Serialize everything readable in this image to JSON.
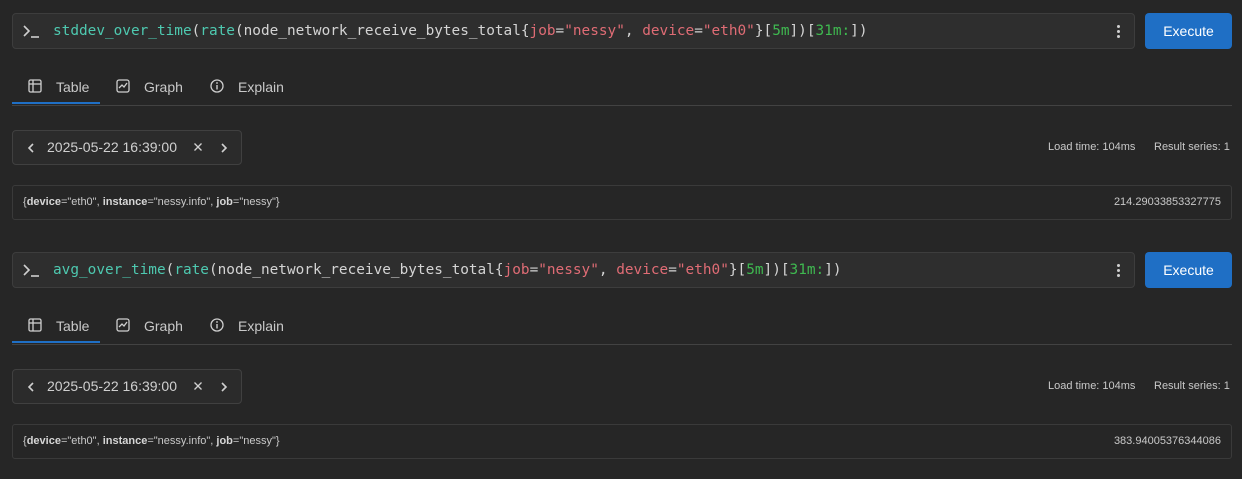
{
  "panels": [
    {
      "query": {
        "fn": "stddev_over_time",
        "inner_fn": "rate",
        "metric": "node_network_receive_bytes_total",
        "label1_name": "job",
        "label1_value": "\"nessy\"",
        "label2_name": "device",
        "label2_value": "\"eth0\"",
        "range": "5m",
        "subquery": "31m:"
      },
      "execute_label": "Execute",
      "tabs": [
        {
          "label": "Table",
          "icon": "table-icon",
          "active": true
        },
        {
          "label": "Graph",
          "icon": "graph-icon",
          "active": false
        },
        {
          "label": "Explain",
          "icon": "info-icon",
          "active": false
        }
      ],
      "eval_time": "2025-05-22 16:39:00",
      "load_time": "Load time: 104ms",
      "result_series": "Result series: 1",
      "result": {
        "open_brace": "{",
        "l1_name": "device",
        "l1_eq": "=\"eth0\", ",
        "l2_name": "instance",
        "l2_eq": "=\"nessy.info\", ",
        "l3_name": "job",
        "l3_eq": "=\"nessy\"",
        "close_brace": "}",
        "value": "214.29033853327775"
      }
    },
    {
      "query": {
        "fn": "avg_over_time",
        "inner_fn": "rate",
        "metric": "node_network_receive_bytes_total",
        "label1_name": "job",
        "label1_value": "\"nessy\"",
        "label2_name": "device",
        "label2_value": "\"eth0\"",
        "range": "5m",
        "subquery": "31m:"
      },
      "execute_label": "Execute",
      "tabs": [
        {
          "label": "Table",
          "icon": "table-icon",
          "active": true
        },
        {
          "label": "Graph",
          "icon": "graph-icon",
          "active": false
        },
        {
          "label": "Explain",
          "icon": "info-icon",
          "active": false
        }
      ],
      "eval_time": "2025-05-22 16:39:00",
      "load_time": "Load time: 104ms",
      "result_series": "Result series: 1",
      "result": {
        "open_brace": "{",
        "l1_name": "device",
        "l1_eq": "=\"eth0\", ",
        "l2_name": "instance",
        "l2_eq": "=\"nessy.info\", ",
        "l3_name": "job",
        "l3_eq": "=\"nessy\"",
        "close_brace": "}",
        "value": "383.94005376344086"
      }
    }
  ],
  "colors": {
    "background": "#262626",
    "accent": "#1f6fc5",
    "function": "#4ec9b0",
    "label_value": "#e06c75",
    "number": "#3fb950"
  }
}
